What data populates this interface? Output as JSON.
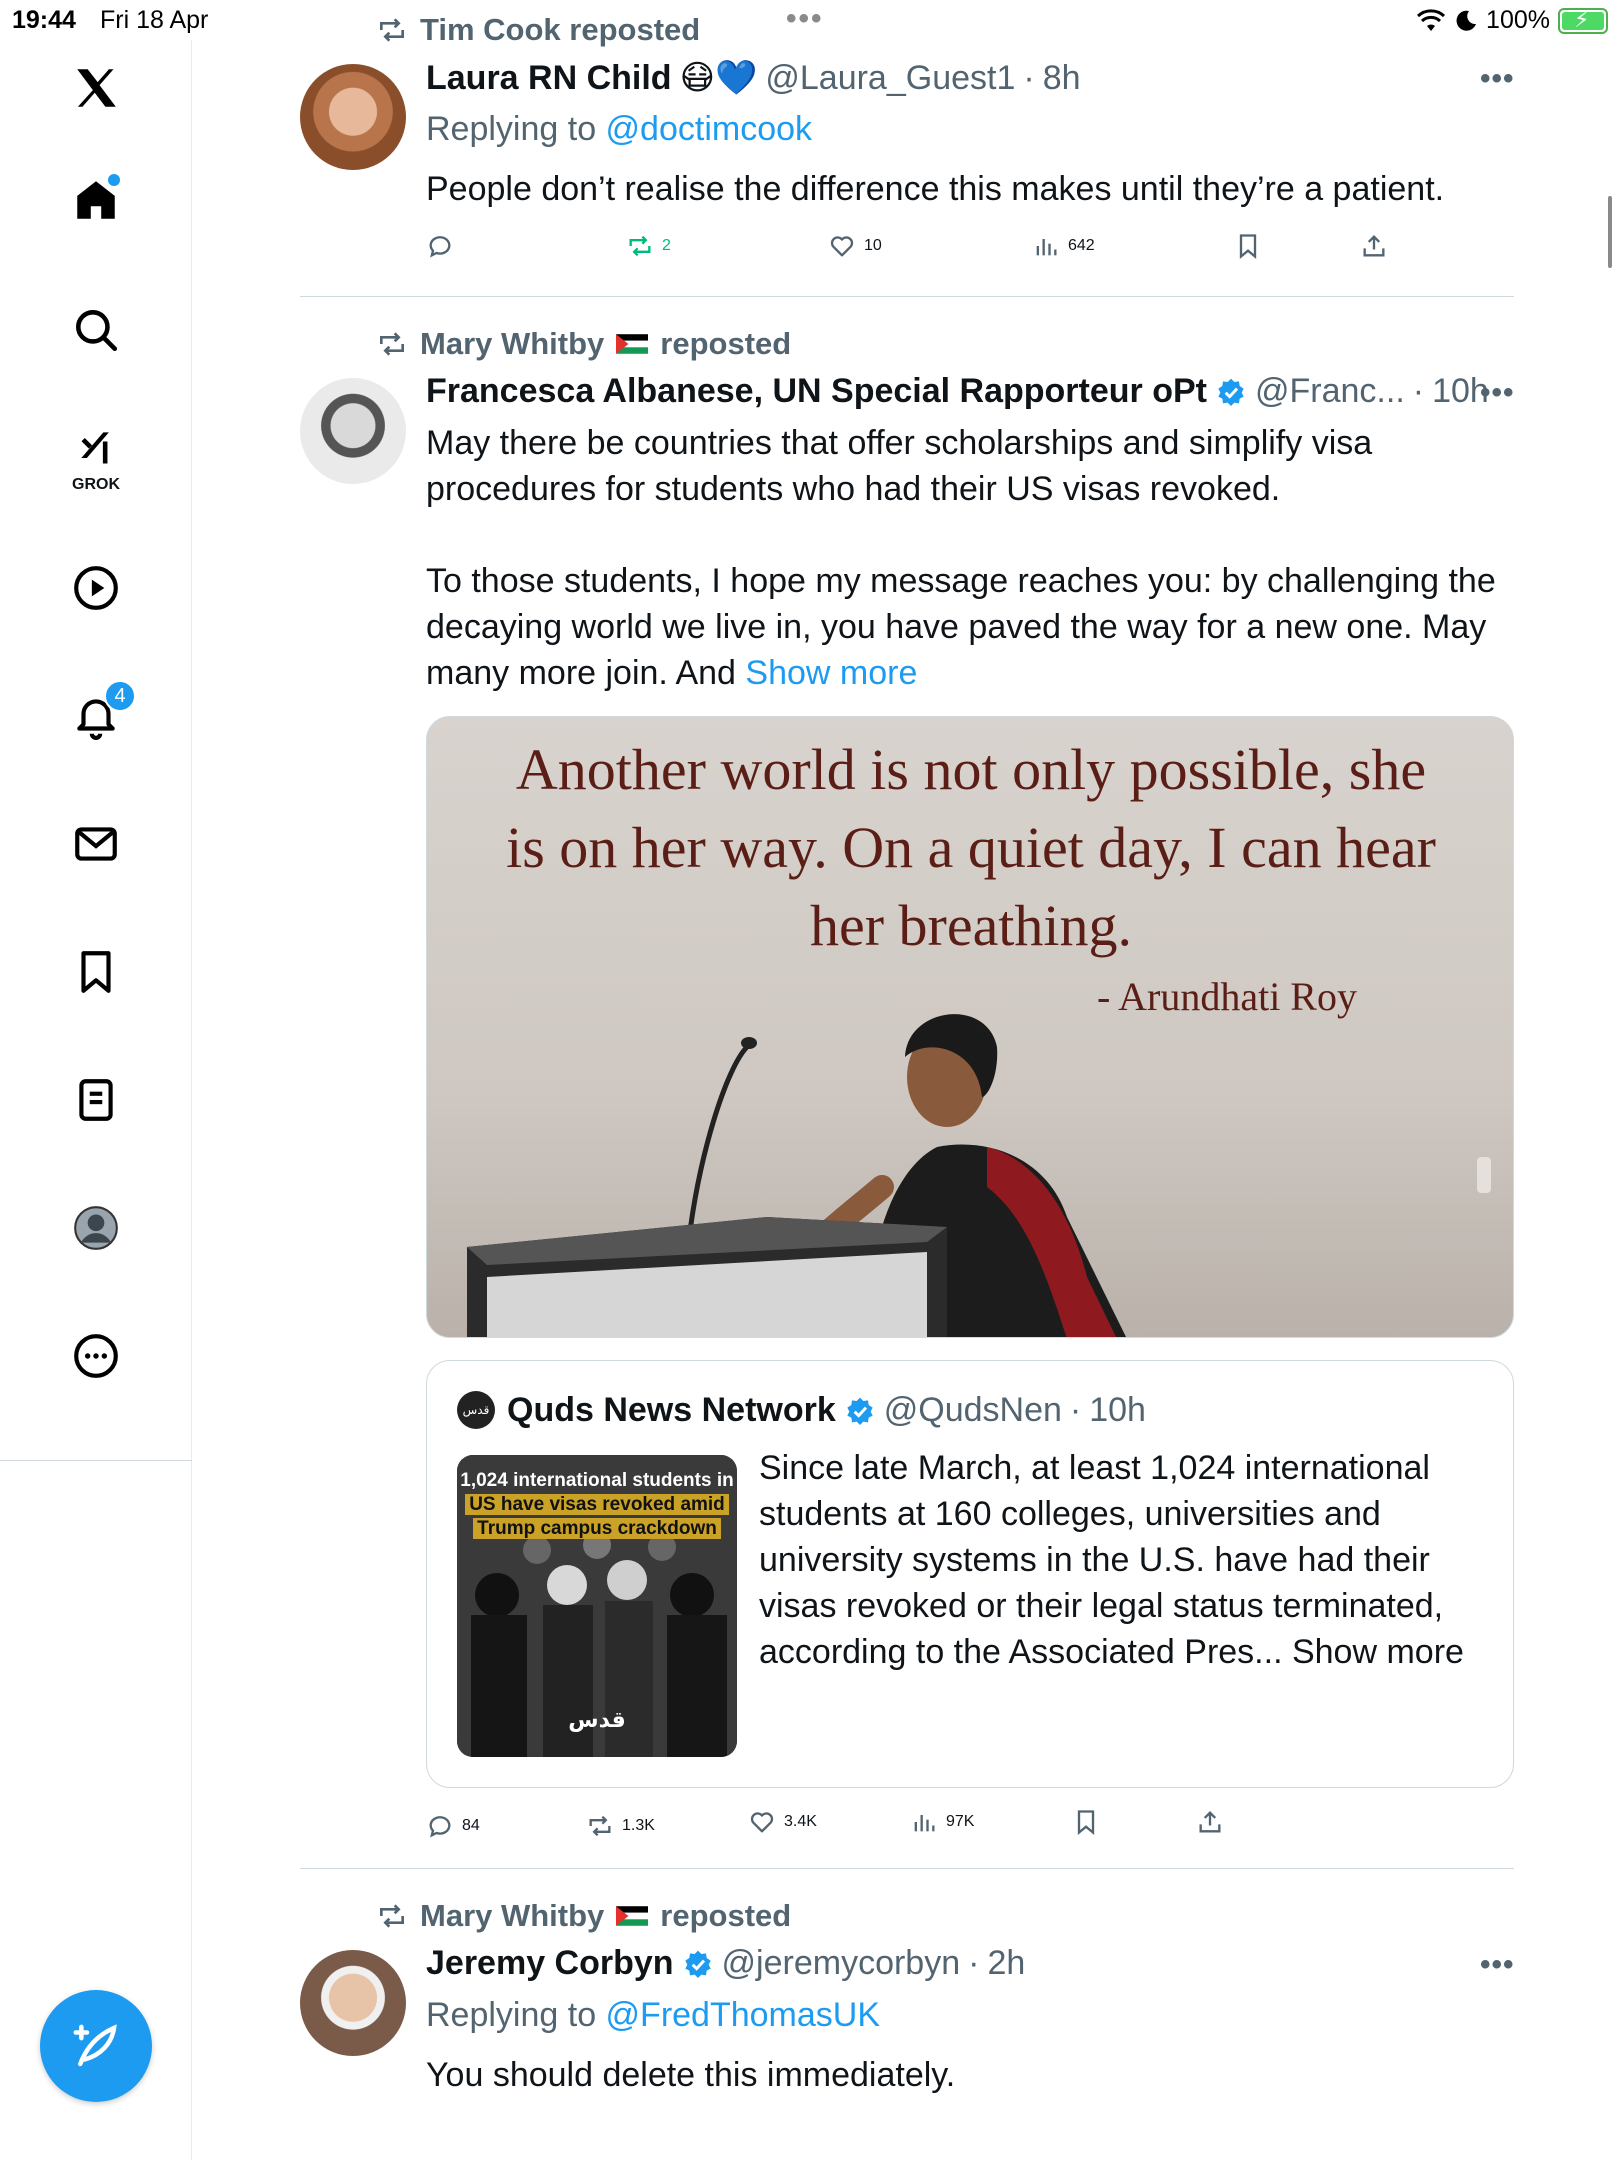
{
  "status_bar": {
    "time": "19:44",
    "date": "Fri 18 Apr",
    "battery": "100%"
  },
  "sidebar": {
    "notifications_count": "4",
    "grok_label": "GROK"
  },
  "feed": {
    "tweets": [
      {
        "repost_by": "Tim Cook reposted",
        "name": "Laura RN Child",
        "name_emoji": "😷💙",
        "handle": "@Laura_Guest1",
        "time": "8h",
        "replying_prefix": "Replying to ",
        "replying_to": "@doctimcook",
        "text": "People don’t realise the difference this makes until they’re a patient.",
        "stats": {
          "replies": "",
          "reposts": "2",
          "likes": "10",
          "views": "642"
        }
      },
      {
        "repost_by_name": "Mary Whitby",
        "repost_suffix": "reposted",
        "name": "Francesca Albanese, UN Special Rapporteur oPt",
        "handle": "@Franc...",
        "time": "10h",
        "text_p1": "May there be countries that offer scholarships and simplify visa procedures for students who had their US visas revoked.",
        "text_p2": "To those students, I hope my message reaches you: by challenging the decaying world we live in, you have paved the way for a new one. May many more join. And ",
        "show_more": "Show more",
        "media": {
          "quote_line1": "Another world is not only possible, she",
          "quote_line2": "is on her way. On a quiet day, I can hear",
          "quote_line3": "her breathing.",
          "quote_author": "- Arundhati Roy"
        },
        "quoted": {
          "name": "Quds News Network",
          "handle": "@QudsNen",
          "time": "10h",
          "thumb_line1": "1,024 international students in",
          "thumb_line2": "US have visas revoked amid",
          "thumb_line3": "Trump campus crackdown",
          "thumb_logo": "قدس",
          "avatar_logo": "قدس",
          "text": "Since late March, at least 1,024 international students at 160 colleges, universities and university systems in the U.S. have had their visas revoked or their legal status terminated, according to the Associated Pres... Show more"
        },
        "stats": {
          "replies": "84",
          "reposts": "1.3K",
          "likes": "3.4K",
          "views": "97K"
        }
      },
      {
        "repost_by_name": "Mary Whitby",
        "repost_suffix": "reposted",
        "name": "Jeremy Corbyn",
        "handle": "@jeremycorbyn",
        "time": "2h",
        "replying_prefix": "Replying to ",
        "replying_to": "@FredThomasUK",
        "text": "You should delete this immediately."
      }
    ]
  },
  "colors": {
    "accent": "#1d9bf0",
    "repost_green": "#00ba7c",
    "secondary": "#536471"
  }
}
